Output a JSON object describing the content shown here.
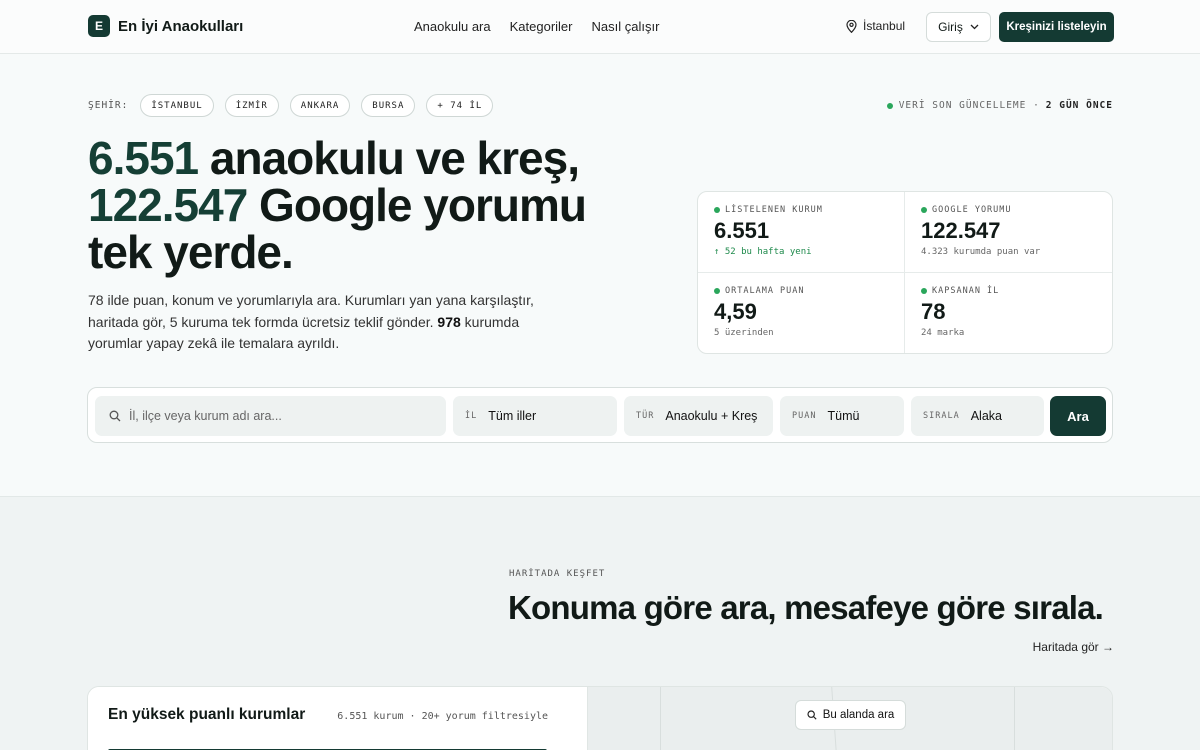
{
  "header": {
    "logo_letter": "E",
    "brand": "En İyi Anaokulları",
    "nav": [
      "Anaokulu ara",
      "Kategoriler",
      "Nasıl çalışır"
    ],
    "location": "İstanbul",
    "login_label": "Giriş",
    "cta_label": "Kreşinizi listeleyin"
  },
  "cities": {
    "label": "ŞEHİR:",
    "chips": [
      "İSTANBUL",
      "İZMİR",
      "ANKARA",
      "BURSA",
      "+ 74 İL"
    ]
  },
  "update": {
    "label": "VERİ SON GÜNCELLEME ·",
    "value": "2 GÜN ÖNCE"
  },
  "hero": {
    "num1": "6.551",
    "text1": " anaokulu ve kreş, ",
    "num2": "122.547",
    "text2": " Google yorumu tek yerde.",
    "sub_before": "78 ilde puan, konum ve yorumlarıyla ara. Kurumları yan yana karşılaştır, haritada gör, 5 kuruma tek formda ücretsiz teklif gönder. ",
    "sub_bold": "978",
    "sub_after": " kurumda yorumlar yapay zekâ ile temalara ayrıldı."
  },
  "stats": [
    {
      "label": "LİSTELENEN KURUM",
      "value": "6.551",
      "note": "↑ 52 bu hafta yeni"
    },
    {
      "label": "GOOGLE YORUMU",
      "value": "122.547",
      "note": "4.323 kurumda puan var"
    },
    {
      "label": "ORTALAMA PUAN",
      "value": "4,59",
      "note": "5 üzerinden"
    },
    {
      "label": "KAPSANAN İL",
      "value": "78",
      "note": "24 marka"
    }
  ],
  "search": {
    "placeholder": "İl, ilçe veya kurum adı ara...",
    "il_key": "İL",
    "il_value": "Tüm iller",
    "tur_key": "TÜR",
    "tur_value": "Anaokulu + Kreş",
    "puan_key": "PUAN",
    "puan_value": "Tümü",
    "sira_key": "SIRALA",
    "sira_value": "Alaka",
    "button": "Ara"
  },
  "map_section": {
    "eyebrow": "HARİTADA KEŞFET",
    "title": "Konuma göre ara, mesafeye göre sırala.",
    "link": "Haritada gör →",
    "panel_title": "En yüksek puanlı kurumlar",
    "panel_meta": "6.551 kurum · 20+ yorum filtresiyle",
    "area_button": "Bu alanda ara"
  },
  "colors": {
    "brand_dark": "#143a33",
    "accent_green": "#2aa65b",
    "hero_number": "#153f35"
  }
}
